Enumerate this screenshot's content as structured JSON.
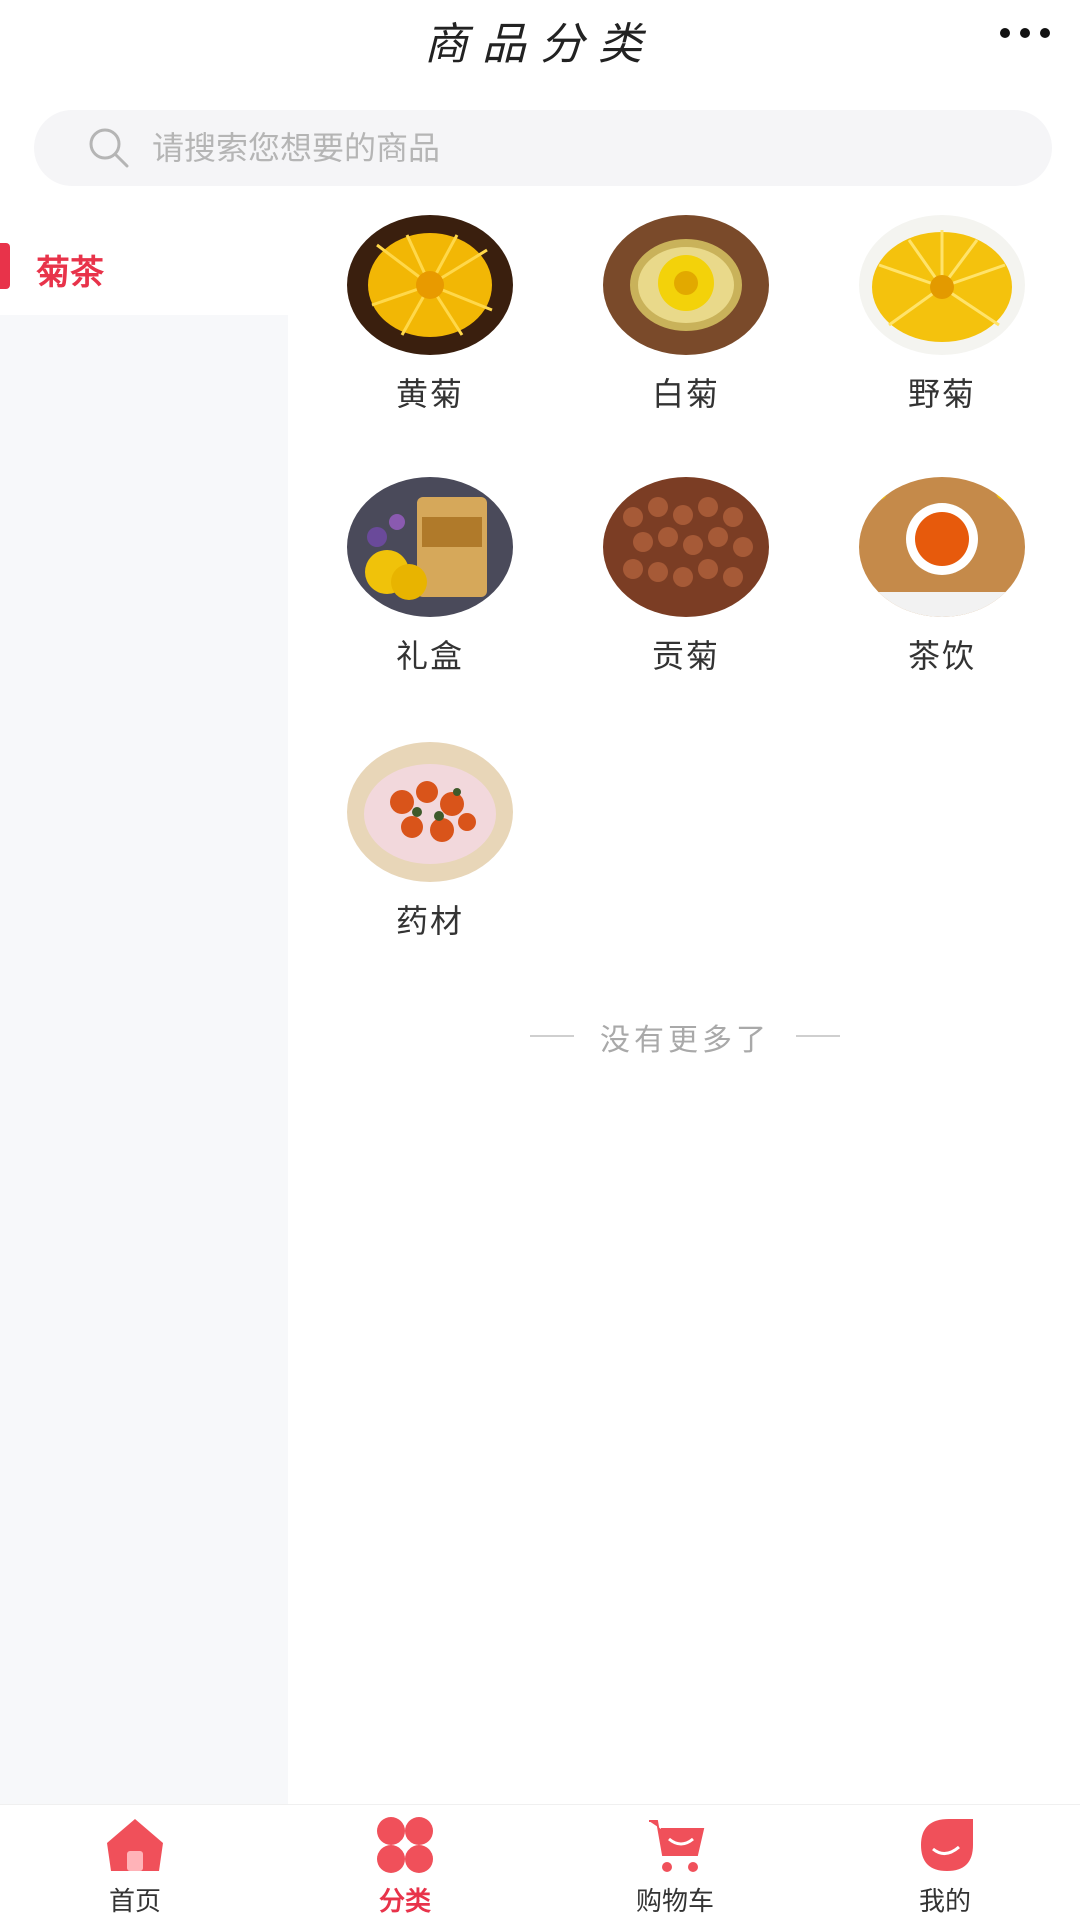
{
  "header": {
    "title": "商品分类",
    "more_icon": "more-dots-icon"
  },
  "search": {
    "placeholder": "请搜索您想要的商品",
    "value": "",
    "icon": "search-icon"
  },
  "sidebar": {
    "items": [
      {
        "label": "菊茶",
        "active": true
      }
    ]
  },
  "categories": [
    {
      "name": "黄菊"
    },
    {
      "name": "白菊"
    },
    {
      "name": "野菊"
    },
    {
      "name": "礼盒"
    },
    {
      "name": "贡菊"
    },
    {
      "name": "茶饮"
    },
    {
      "name": "药材"
    }
  ],
  "footer_note": "没有更多了",
  "tabbar": {
    "items": [
      {
        "label": "首页",
        "icon": "home-icon",
        "active": false
      },
      {
        "label": "分类",
        "icon": "category-icon",
        "active": true
      },
      {
        "label": "购物车",
        "icon": "cart-icon",
        "active": false
      },
      {
        "label": "我的",
        "icon": "profile-icon",
        "active": false
      }
    ]
  },
  "colors": {
    "accent": "#e8334a",
    "sidebar_bg": "#f7f8fa",
    "search_bg": "#f5f5f7"
  }
}
